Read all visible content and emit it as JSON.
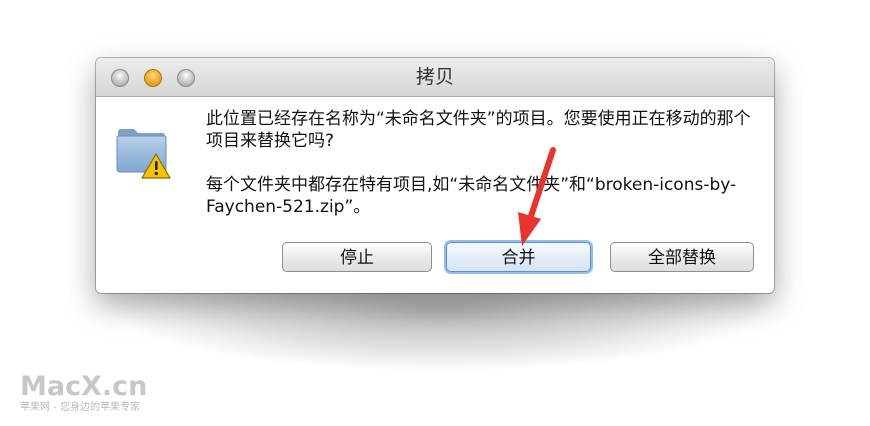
{
  "window": {
    "title": "拷贝"
  },
  "dialog": {
    "message_primary": "此位置已经存在名称为“未命名文件夹”的项目。您要使用正在移动的那个项目来替换它吗?",
    "message_secondary": "每个文件夹中都存在特有项目,如“未命名文件夹”和“broken-icons-by-Faychen-521.zip”。",
    "buttons": {
      "stop": "停止",
      "merge": "合并",
      "replace_all": "全部替换"
    }
  },
  "watermark": {
    "logo": "MacX.cn",
    "tagline": "苹果网 - 您身边的苹果专家"
  },
  "icons": [
    "folder-warning-icon",
    "red-arrow-annotation"
  ],
  "colors": {
    "arrow": "#e8342a",
    "default_button_glow": "#93bdf0",
    "folder": "#8fb3d9",
    "warning": "#f5c400"
  }
}
